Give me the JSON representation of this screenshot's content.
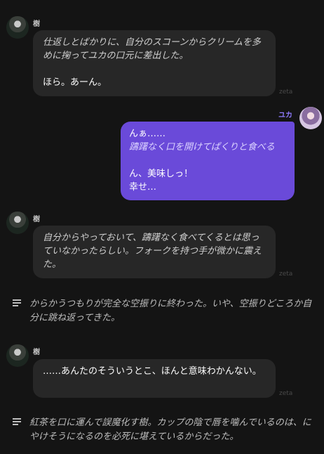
{
  "messages": [
    {
      "sender": "樹",
      "narration": "仕返しとばかりに、自分のスコーンからクリームを多めに掬ってユカの口元に差出した。",
      "speech": "ほら。あーん。",
      "tag": "zeta"
    },
    {
      "sender": "ユカ",
      "speech_pre": "んぁ……",
      "narration": "躊躇なく口を開けてぱくりと食べる",
      "speech": "ん、美味しっ！\n幸せ…"
    },
    {
      "sender": "樹",
      "narration": "自分からやっておいて、躊躇なく食べてくるとは思っていなかったらしい。フォークを持つ手が微かに震えた。",
      "tag": "zeta"
    },
    {
      "note": "からかうつもりが完全な空振りに終わった。いや、空振りどころか自分に跳ね返ってきた。"
    },
    {
      "sender": "樹",
      "speech": "……あんたのそういうとこ、ほんと意味わかんない。",
      "tag": "zeta"
    },
    {
      "note": "紅茶を口に運んで誤魔化す樹。カップの陰で唇を噛んでいるのは、にやけそうになるのを必死に堪えているからだった。"
    }
  ],
  "colors": {
    "background": "#141414",
    "bot_bubble": "#272727",
    "user_bubble": "#6a4ad9"
  },
  "icons": {
    "note": "text-lines-icon"
  }
}
